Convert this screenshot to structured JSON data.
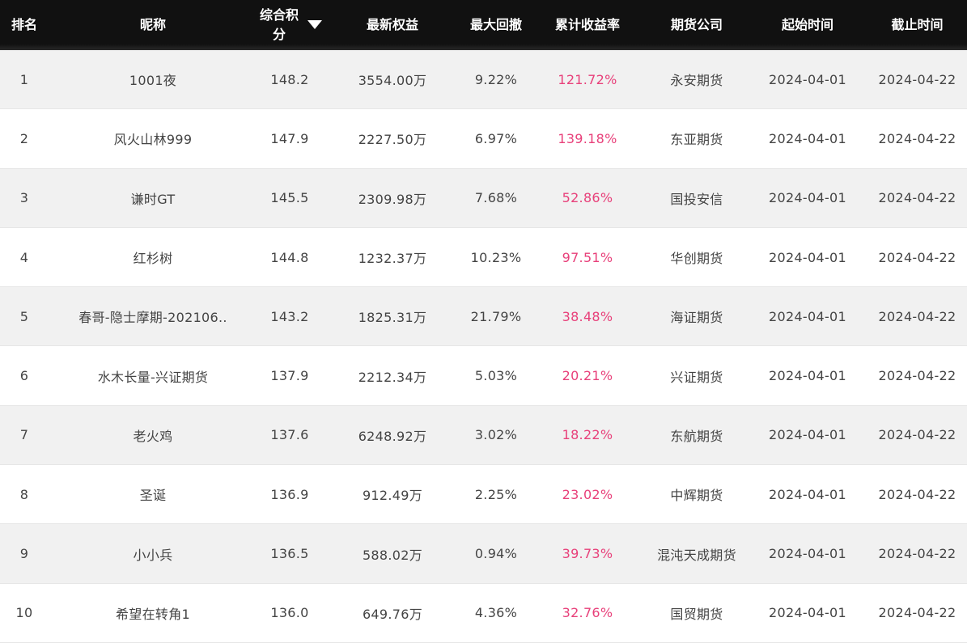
{
  "table": {
    "columns": {
      "rank": "排名",
      "nickname": "昵称",
      "score": "综合积分",
      "equity": "最新权益",
      "drawdown": "最大回撤",
      "cumulative_return": "累计收益率",
      "company": "期货公司",
      "start": "起始时间",
      "end": "截止时间"
    },
    "sort_icon": "caret-down-icon",
    "colors": {
      "header_bg": "#111111",
      "return_text": "#e8407a",
      "row_alt": "#f1f1f1"
    },
    "rows": [
      {
        "rank": "1",
        "nickname": "1001夜",
        "score": "148.2",
        "equity": "3554.00万",
        "drawdown": "9.22%",
        "cumulative_return": "121.72%",
        "company": "永安期货",
        "start": "2024-04-01",
        "end": "2024-04-22"
      },
      {
        "rank": "2",
        "nickname": "风火山林999",
        "score": "147.9",
        "equity": "2227.50万",
        "drawdown": "6.97%",
        "cumulative_return": "139.18%",
        "company": "东亚期货",
        "start": "2024-04-01",
        "end": "2024-04-22"
      },
      {
        "rank": "3",
        "nickname": "谦时GT",
        "score": "145.5",
        "equity": "2309.98万",
        "drawdown": "7.68%",
        "cumulative_return": "52.86%",
        "company": "国投安信",
        "start": "2024-04-01",
        "end": "2024-04-22"
      },
      {
        "rank": "4",
        "nickname": "红杉树",
        "score": "144.8",
        "equity": "1232.37万",
        "drawdown": "10.23%",
        "cumulative_return": "97.51%",
        "company": "华创期货",
        "start": "2024-04-01",
        "end": "2024-04-22"
      },
      {
        "rank": "5",
        "nickname": "春哥-隐士摩期-202106..",
        "score": "143.2",
        "equity": "1825.31万",
        "drawdown": "21.79%",
        "cumulative_return": "38.48%",
        "company": "海证期货",
        "start": "2024-04-01",
        "end": "2024-04-22"
      },
      {
        "rank": "6",
        "nickname": "水木长量-兴证期货",
        "score": "137.9",
        "equity": "2212.34万",
        "drawdown": "5.03%",
        "cumulative_return": "20.21%",
        "company": "兴证期货",
        "start": "2024-04-01",
        "end": "2024-04-22"
      },
      {
        "rank": "7",
        "nickname": "老火鸡",
        "score": "137.6",
        "equity": "6248.92万",
        "drawdown": "3.02%",
        "cumulative_return": "18.22%",
        "company": "东航期货",
        "start": "2024-04-01",
        "end": "2024-04-22"
      },
      {
        "rank": "8",
        "nickname": "圣诞",
        "score": "136.9",
        "equity": "912.49万",
        "drawdown": "2.25%",
        "cumulative_return": "23.02%",
        "company": "中辉期货",
        "start": "2024-04-01",
        "end": "2024-04-22"
      },
      {
        "rank": "9",
        "nickname": "小小兵",
        "score": "136.5",
        "equity": "588.02万",
        "drawdown": "0.94%",
        "cumulative_return": "39.73%",
        "company": "混沌天成期货",
        "start": "2024-04-01",
        "end": "2024-04-22"
      },
      {
        "rank": "10",
        "nickname": "希望在转角1",
        "score": "136.0",
        "equity": "649.76万",
        "drawdown": "4.36%",
        "cumulative_return": "32.76%",
        "company": "国贸期货",
        "start": "2024-04-01",
        "end": "2024-04-22"
      }
    ]
  }
}
